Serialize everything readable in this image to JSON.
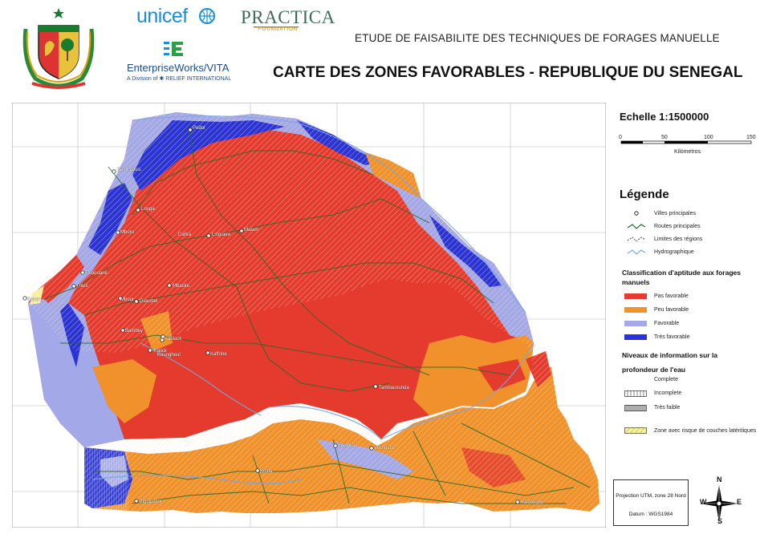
{
  "logos": {
    "unicef": "unicef",
    "practica": "PRACTICA",
    "practica_sub": "FOUNDATION",
    "enterpriseworks": "EnterpriseWorks/VITA",
    "enterpriseworks_sub": "A Division of ✱ RELIEF INTERNATIONAL"
  },
  "header": {
    "subtitle": "ETUDE DE FAISABILITE  DES TECHNIQUES DE FORAGES MANUELLE",
    "title": "CARTE DES ZONES FAVORABLES - REPUBLIQUE DU SENEGAL"
  },
  "scale": {
    "title": "Echelle 1:1500000",
    "ticks": [
      "0",
      "50",
      "100",
      "150"
    ],
    "unit": "Kilómetros"
  },
  "legend": {
    "title": "Légende",
    "reference_items": [
      {
        "label": "Villes principales",
        "icon": "city-dot-icon"
      },
      {
        "label": "Routes principales",
        "icon": "road-line-icon"
      },
      {
        "label": "Limites des régions",
        "icon": "boundary-line-icon"
      },
      {
        "label": "Hydrographique",
        "icon": "river-line-icon"
      }
    ],
    "classification_title": "Classification d'aptitude aux forages manuels",
    "classes": [
      {
        "label": "Pas favorable",
        "color": "#e53b2e"
      },
      {
        "label": "Peu favorable",
        "color": "#f0912b"
      },
      {
        "label": "Favorable",
        "color": "#a3a8e8"
      },
      {
        "label": "Très favorable",
        "color": "#2a33d6"
      }
    ],
    "info_title_1": "Niveaux de information sur la",
    "info_title_2": "profondeur de l'eau",
    "info_levels": [
      {
        "label": "Complete",
        "pattern": "none"
      },
      {
        "label": "Incomplete",
        "pattern": "vertical-sparse"
      },
      {
        "label": "Très faible",
        "pattern": "vertical-dense"
      }
    ],
    "laterite": {
      "label": "Zone avec risque de couches latéritiques",
      "color": "#f6f0a0"
    }
  },
  "projection": {
    "line1": "Projection UTM, zone 28 Nord",
    "line2": "Datum : WGS1984"
  },
  "compass": {
    "n": "N",
    "s": "S",
    "e": "E",
    "w": "W"
  },
  "cities": [
    "Podor",
    "Saint Louis",
    "Louga",
    "Linguere",
    "Matam",
    "Mboro",
    "Thies",
    "Dakar",
    "Diourbel",
    "Kaolack",
    "Fatick",
    "Kaffrine",
    "Tambacounda",
    "Kolda",
    "Ziguinchor",
    "Kedougou",
    "Sedhiou",
    "Velingara",
    "Mbacke",
    "Mbour",
    "Tivaouane",
    "Dahra",
    "Bambey",
    "Koungheul"
  ]
}
